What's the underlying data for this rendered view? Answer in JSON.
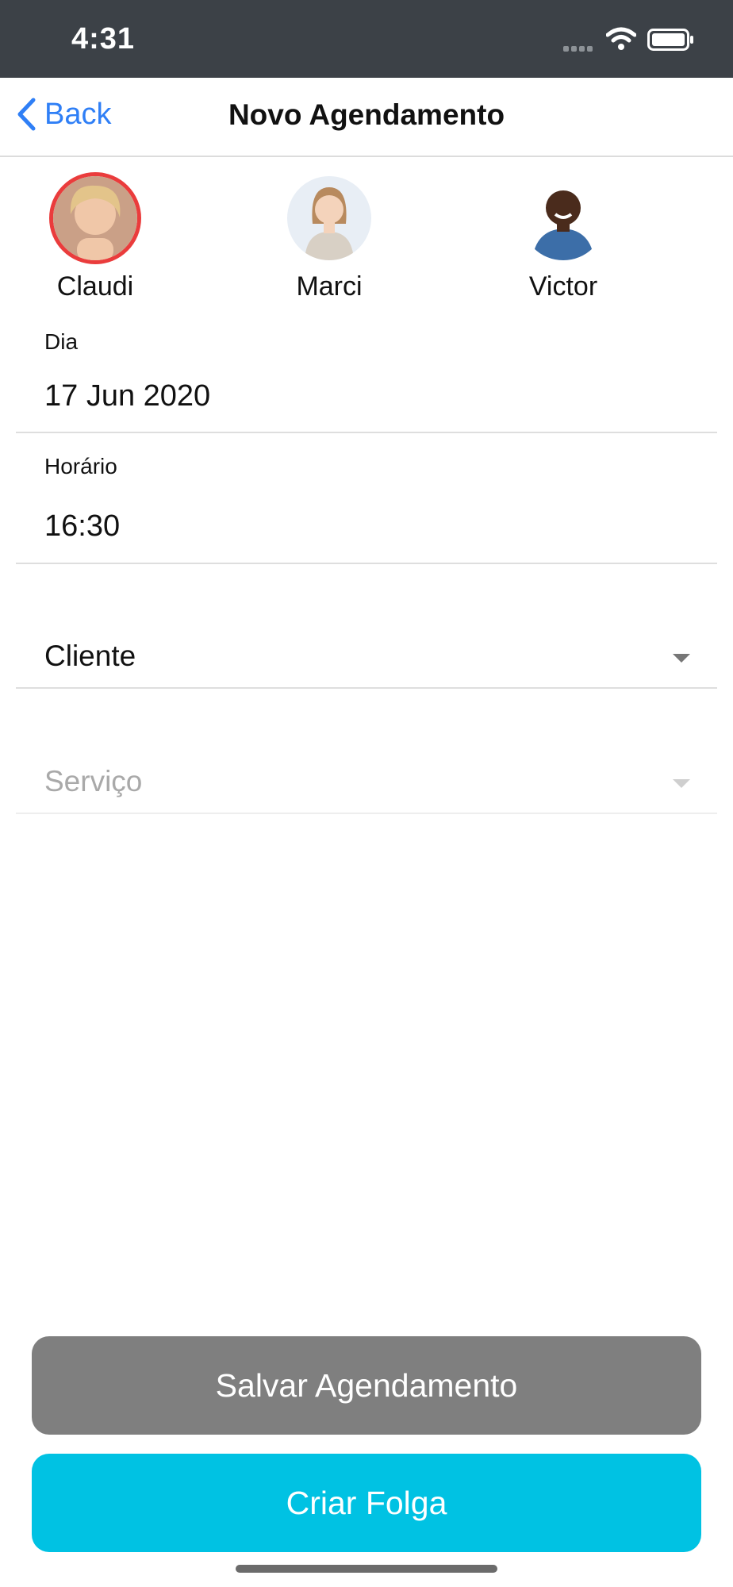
{
  "status_bar": {
    "time": "4:31"
  },
  "nav": {
    "back_label": "Back",
    "title": "Novo Agendamento"
  },
  "staff": [
    {
      "name": "Claudi",
      "selected": true
    },
    {
      "name": "Marci",
      "selected": false
    },
    {
      "name": "Victor",
      "selected": false
    }
  ],
  "form": {
    "day_label": "Dia",
    "day_value": "17 Jun 2020",
    "time_label": "Horário",
    "time_value": "16:30",
    "client_placeholder": "Cliente",
    "service_placeholder": "Serviço"
  },
  "buttons": {
    "save": "Salvar Agendamento",
    "folga": "Criar Folga"
  },
  "colors": {
    "accent": "#2f7ff6",
    "save_button": "#7f7f7f",
    "folga_button": "#00c2e3",
    "selected_ring": "#ea3c3c"
  }
}
